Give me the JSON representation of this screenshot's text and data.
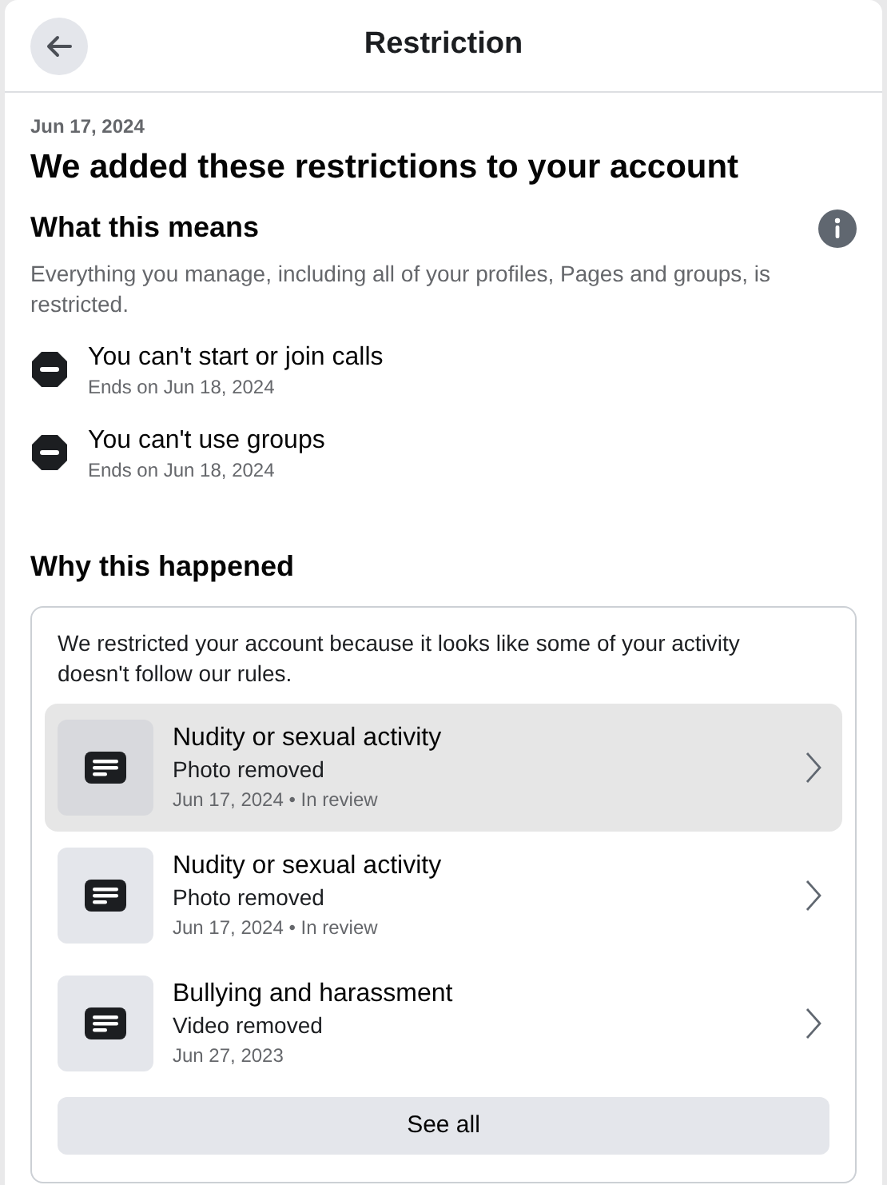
{
  "header": {
    "title": "Restriction"
  },
  "date": "Jun 17, 2024",
  "heading": "We added these restrictions to your account",
  "meaning": {
    "title": "What this means",
    "description": "Everything you manage, including all of your profiles, Pages and groups, is restricted."
  },
  "restrictions": [
    {
      "title": "You can't start or join calls",
      "ends": "Ends on Jun 18, 2024"
    },
    {
      "title": "You can't use groups",
      "ends": "Ends on Jun 18, 2024"
    }
  ],
  "reasons": {
    "title": "Why this happened",
    "description": "We restricted your account because it looks like some of your activity doesn't follow our rules.",
    "items": [
      {
        "title": "Nudity or sexual activity",
        "subtitle": "Photo removed",
        "meta": "Jun 17, 2024 • In review",
        "selected": true
      },
      {
        "title": "Nudity or sexual activity",
        "subtitle": "Photo removed",
        "meta": "Jun 17, 2024 • In review",
        "selected": false
      },
      {
        "title": "Bullying and harassment",
        "subtitle": "Video removed",
        "meta": "Jun 27, 2023",
        "selected": false
      }
    ],
    "button": "See all"
  }
}
